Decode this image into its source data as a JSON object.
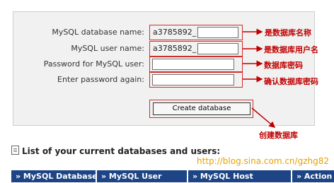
{
  "form": {
    "db_name_label": "MySQL database name:",
    "user_name_label": "MySQL user name:",
    "password_label": "Password for MySQL user:",
    "password_again_label": "Enter password again:",
    "db_prefix": "a3785892_",
    "user_prefix": "a3785892_",
    "db_name_value": "",
    "user_name_value": "",
    "password_value": "",
    "password_again_value": "",
    "create_button": "Create database"
  },
  "annotations": {
    "db_name": "是数据库名称",
    "user_name": "是数据库用户名",
    "password": "数据库密码",
    "password_again": "确认数据库密码",
    "create": "创建数据库"
  },
  "list": {
    "title": "List of your current databases and users:",
    "columns": [
      "» MySQL Database",
      "» MySQL User",
      "» MySQL Host",
      "» Action"
    ]
  },
  "watermark": "http://blog.sina.com.cn/gzhg82",
  "colors": {
    "panel_bg": "#f1f1f1",
    "annotation_red": "#c00000",
    "header_blue": "#1d4484",
    "url_orange": "#e8a000"
  }
}
